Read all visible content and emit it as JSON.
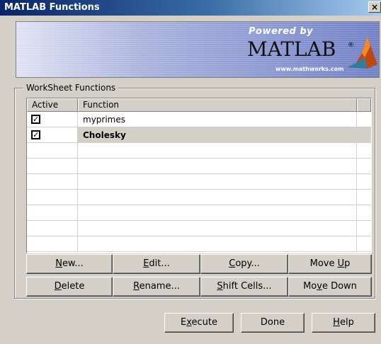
{
  "window": {
    "title": "MATLAB Functions",
    "close_label": "×"
  },
  "banner": {
    "powered_by": "Powered by",
    "brand": "MATLAB",
    "reg": "®",
    "url": "www.mathworks.com"
  },
  "group": {
    "label": "WorkSheet Functions"
  },
  "table": {
    "columns": [
      "Active",
      "Function"
    ],
    "rows": [
      {
        "active": true,
        "active_glyph": "✓",
        "function": "myprimes"
      },
      {
        "active": true,
        "active_glyph": "✓",
        "function": "Cholesky"
      }
    ]
  },
  "buttons": {
    "new": {
      "pre": "",
      "u": "N",
      "post": "ew..."
    },
    "edit": {
      "pre": "",
      "u": "E",
      "post": "dit..."
    },
    "copy": {
      "pre": "",
      "u": "C",
      "post": "opy..."
    },
    "move_up": {
      "pre": "Move ",
      "u": "U",
      "post": "p"
    },
    "delete": {
      "pre": "",
      "u": "D",
      "post": "elete"
    },
    "rename": {
      "pre": "",
      "u": "R",
      "post": "ename..."
    },
    "shift_cells": {
      "pre": "",
      "u": "S",
      "post": "hift Cells..."
    },
    "move_down": {
      "pre": "Mo",
      "u": "v",
      "post": "e Down"
    },
    "execute": {
      "pre": "E",
      "u": "x",
      "post": "ecute"
    },
    "done": {
      "pre": "Done",
      "u": "",
      "post": ""
    },
    "help": {
      "pre": "",
      "u": "H",
      "post": "elp"
    }
  }
}
